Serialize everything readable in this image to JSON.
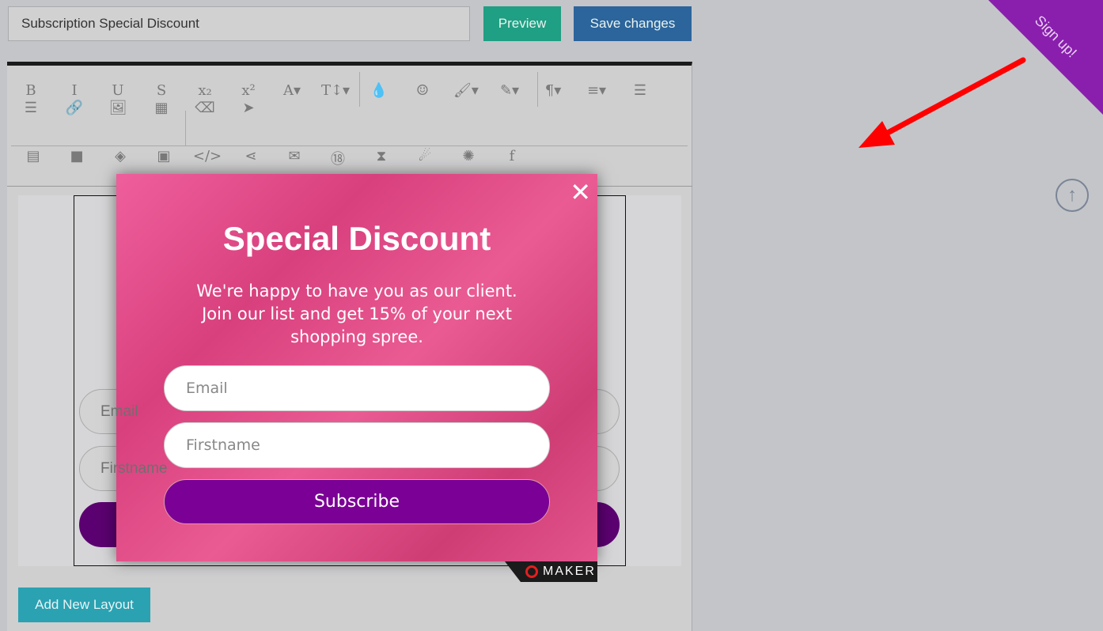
{
  "header": {
    "title_value": "Subscription Special Discount",
    "preview_label": "Preview",
    "save_label": "Save changes"
  },
  "toolbar": {
    "row1": [
      "B",
      "I",
      "U",
      "S",
      "x₂",
      "x²",
      "A▾",
      "T↕▾",
      "💧",
      "☺",
      "🖌▾",
      "✎▾",
      "¶▾",
      "≡▾",
      "☰"
    ],
    "row2": [
      "☰",
      "🔗",
      "🖼",
      "▦",
      "⌫",
      "➤"
    ],
    "row3": [
      "▤",
      "■",
      "◈",
      "▣",
      "</>",
      "⋖",
      "✉",
      "⑱",
      "⧗",
      "☄",
      "✺",
      "f"
    ]
  },
  "background_form": {
    "email_placeholder": "Email",
    "firstname_placeholder": "Firstname"
  },
  "popup": {
    "title": "Special Discount",
    "text": "We're happy to have you as our client. Join our list and get 15% of your next shopping spree.",
    "email_placeholder": "Email",
    "firstname_placeholder": "Firstname",
    "subscribe_label": "Subscribe",
    "close": "✕",
    "brand": "MAKER",
    "bg_color": "#e85a96",
    "button_color": "#7b0095"
  },
  "add_layout_label": "Add New Layout",
  "ribbon_label": "Sign up!",
  "scroll_top_icon": "↑"
}
